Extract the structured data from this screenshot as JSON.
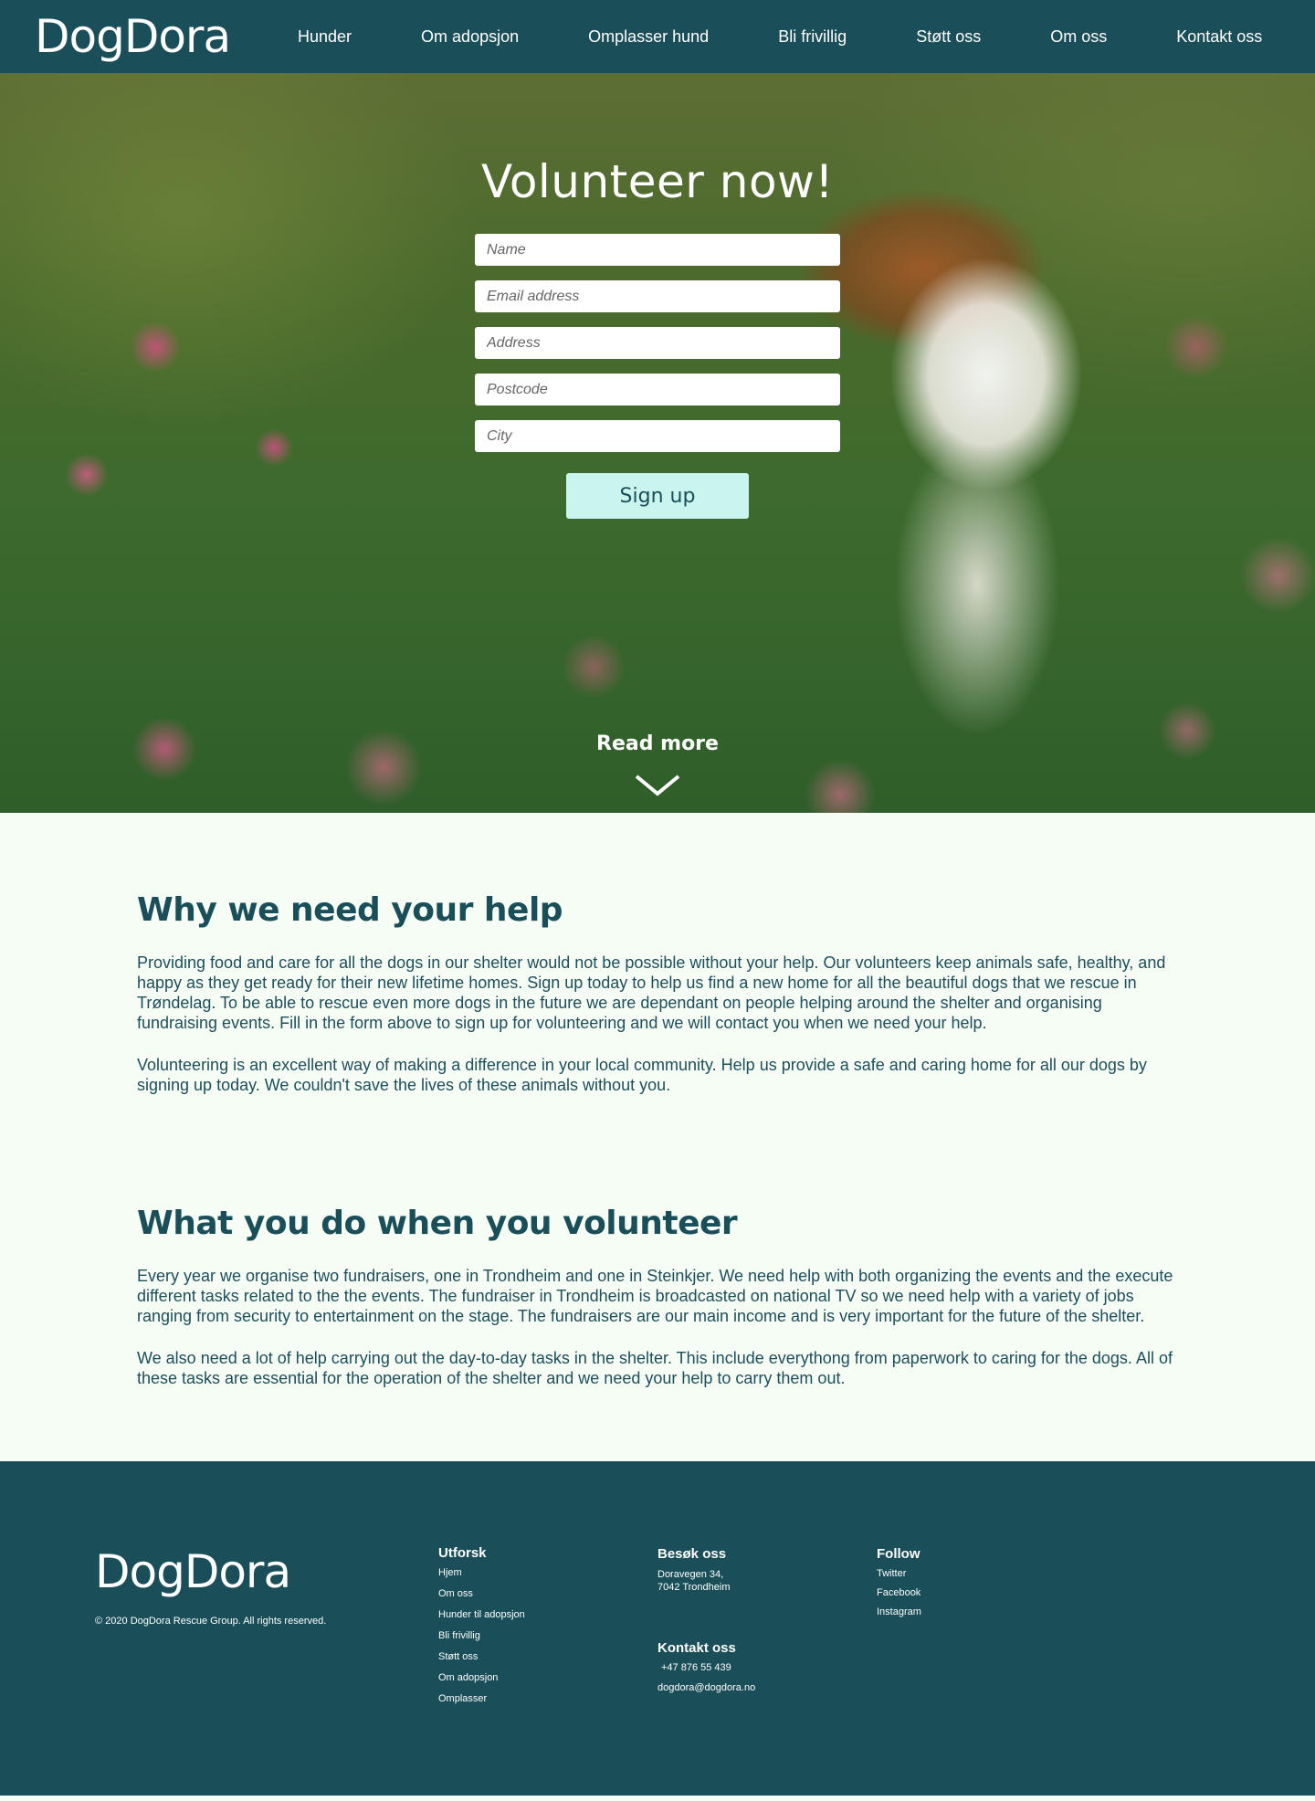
{
  "nav": {
    "logo": "DogDora",
    "links": [
      "Hunder",
      "Om adopsjon",
      "Omplasser hund",
      "Bli frivillig",
      "Støtt oss",
      "Om oss",
      "Kontakt oss"
    ]
  },
  "hero": {
    "title": "Volunteer now!",
    "fields": {
      "name": "Name",
      "email": "Email address",
      "address": "Address",
      "postcode": "Postcode",
      "city": "City"
    },
    "signup_label": "Sign up",
    "read_more": "Read more"
  },
  "sections": {
    "why": {
      "title": "Why we need your help",
      "p1": "Providing food and care for all the dogs in our shelter would not be possible without your help. Our volunteers keep animals safe, healthy, and happy as they get ready for their new lifetime homes. Sign up today to help us find a new home for all the beautiful dogs that we rescue in Trøndelag. To be able to rescue even more dogs in the future we are dependant on people helping around the shelter and organising fundraising events. Fill in the form above to sign up for volunteering and we will contact you when we need your help.",
      "p2": "Volunteering is an excellent way of making a difference in your local community. Help us provide a safe and caring home for all our dogs by signing up today. We couldn't save the lives of these animals without you."
    },
    "what": {
      "title": "What you do when you volunteer",
      "p1": "Every year we organise two fundraisers, one in Trondheim and one in Steinkjer. We need help with both organizing the events and the execute different tasks related to the the events. The fundraiser in Trondheim is broadcasted on national TV so we need help with a variety of jobs ranging from security to entertainment on the stage. The fundraisers are our main income and is very important for the future of the shelter.",
      "p2": "We also need a lot of help carrying out the day-to-day tasks in the shelter. This include everythong from paperwork to caring for the dogs. All of these tasks are essential for the operation of the shelter and we need your help to carry them out."
    }
  },
  "footer": {
    "logo": "DogDora",
    "copyright": "© 2020 DogDora Rescue Group. All rights reserved.",
    "explore": {
      "title": "Utforsk",
      "links": [
        "Hjem",
        "Om oss",
        "Hunder til adopsjon",
        "Bli frivillig",
        "Støtt oss",
        "Om adopsjon",
        "Omplasser"
      ]
    },
    "visit": {
      "title": "Besøk oss",
      "line1": "Doravegen 34,",
      "line2": "7042 Trondheim"
    },
    "contact": {
      "title": "Kontakt oss",
      "phone": "+47 876 55 439",
      "email": "dogdora@dogdora.no"
    },
    "follow": {
      "title": "Follow",
      "links": [
        "Twitter",
        "Facebook",
        "Instagram"
      ]
    }
  },
  "colors": {
    "brand": "#1a4f5a",
    "background": "#f6fdf5",
    "button": "#c9f5ee"
  }
}
